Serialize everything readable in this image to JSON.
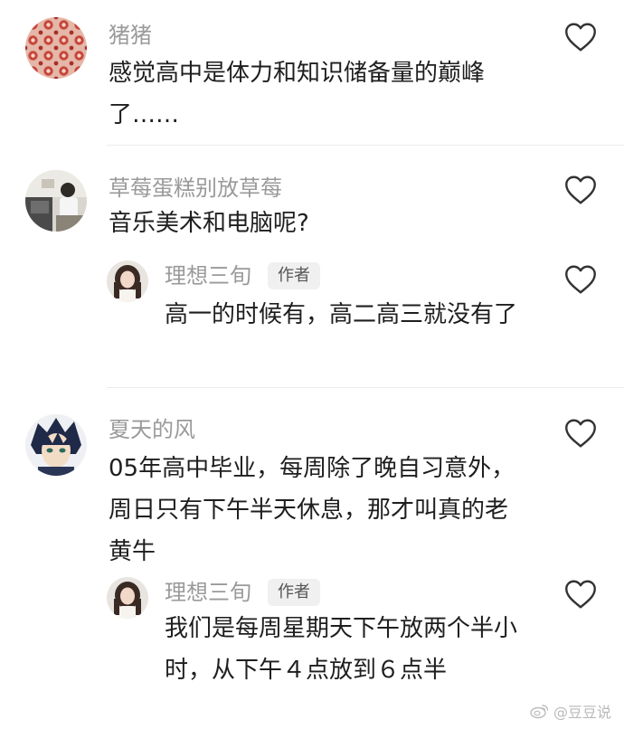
{
  "comments": [
    {
      "username": "猪猪",
      "text_lines": [
        "感觉高中是体力和知识储备量的巅峰",
        "了……"
      ],
      "avatar": "red-floral-pattern"
    },
    {
      "username": "草莓蛋糕别放草莓",
      "text_lines": [
        "音乐美术和电脑呢?"
      ],
      "avatar": "classroom-photo",
      "reply": {
        "username": "理想三旬",
        "badge": "作者",
        "text_lines": [
          "高一的时候有，高二高三就没有了"
        ],
        "avatar": "girl-portrait"
      }
    },
    {
      "username": "夏天的风",
      "text_lines": [
        "05年高中毕业，每周除了晚自习意外，",
        "周日只有下午半天休息，那才叫真的老",
        "黄牛"
      ],
      "avatar": "anime-character",
      "reply": {
        "username": "理想三旬",
        "badge": "作者",
        "text_lines": [
          "我们是每周星期天下午放两个半小",
          "时，从下午４点放到６点半"
        ],
        "avatar": "girl-portrait"
      }
    }
  ],
  "watermark": {
    "text": "@豆豆说",
    "icon": "weibo-icon"
  },
  "icons": {
    "like": "heart-outline-icon"
  }
}
